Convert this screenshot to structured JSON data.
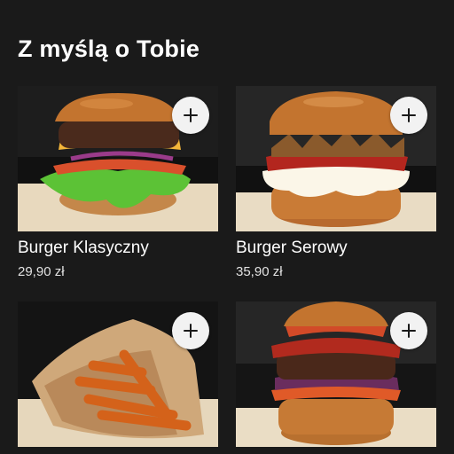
{
  "section": {
    "title": "Z myślą o Tobie"
  },
  "products": [
    {
      "name": "Burger Klasyczny",
      "price": "29,90 zł",
      "image_icon": "classic-burger-image"
    },
    {
      "name": "Burger Serowy",
      "price": "35,90 zł",
      "image_icon": "cheese-burger-image"
    },
    {
      "name": "",
      "price": "",
      "image_icon": "fries-image"
    },
    {
      "name": "",
      "price": "",
      "image_icon": "bacon-burger-image"
    }
  ],
  "actions": {
    "add_icon": "plus-icon"
  },
  "colors": {
    "background": "#1a1a1a",
    "text": "#ffffff",
    "add_button": "#f2f2f2"
  }
}
